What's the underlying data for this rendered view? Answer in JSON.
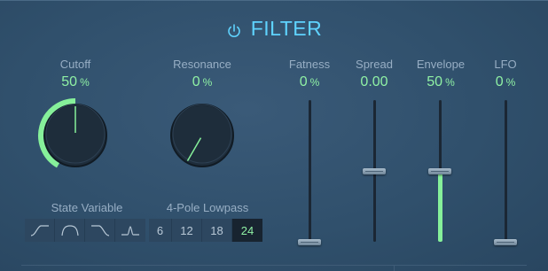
{
  "header": {
    "title": "FILTER",
    "power_icon": "power-icon"
  },
  "knobs": [
    {
      "id": "cutoff",
      "label": "Cutoff",
      "value": "50",
      "unit": "%",
      "level": 0.5
    },
    {
      "id": "resonance",
      "label": "Resonance",
      "value": "0",
      "unit": "%",
      "level": 0.0
    }
  ],
  "sliders": [
    {
      "id": "fatness",
      "label": "Fatness",
      "value": "0",
      "unit": "%",
      "level": 0.0,
      "bipolar": false
    },
    {
      "id": "spread",
      "label": "Spread",
      "value": "0.00",
      "unit": "",
      "level": 0.5,
      "bipolar": true
    },
    {
      "id": "envelope",
      "label": "Envelope",
      "value": "50",
      "unit": "%",
      "level": 0.5,
      "bipolar": false
    },
    {
      "id": "lfo",
      "label": "LFO",
      "value": "0",
      "unit": "%",
      "level": 0.0,
      "bipolar": false
    }
  ],
  "state_variable": {
    "label": "State Variable",
    "modes": [
      {
        "name": "lowpass-filter-icon",
        "selected": false
      },
      {
        "name": "bandpass-filter-icon",
        "selected": false
      },
      {
        "name": "highpass-filter-icon",
        "selected": false
      },
      {
        "name": "peak-filter-icon",
        "selected": false
      }
    ]
  },
  "four_pole": {
    "label": "4-Pole Lowpass",
    "slopes": [
      "6",
      "12",
      "18",
      "24"
    ],
    "selected": "24"
  },
  "colors": {
    "accent_blue": "#5fd3ff",
    "value_green": "#8ff0a4",
    "label_gray": "#97aec4"
  }
}
